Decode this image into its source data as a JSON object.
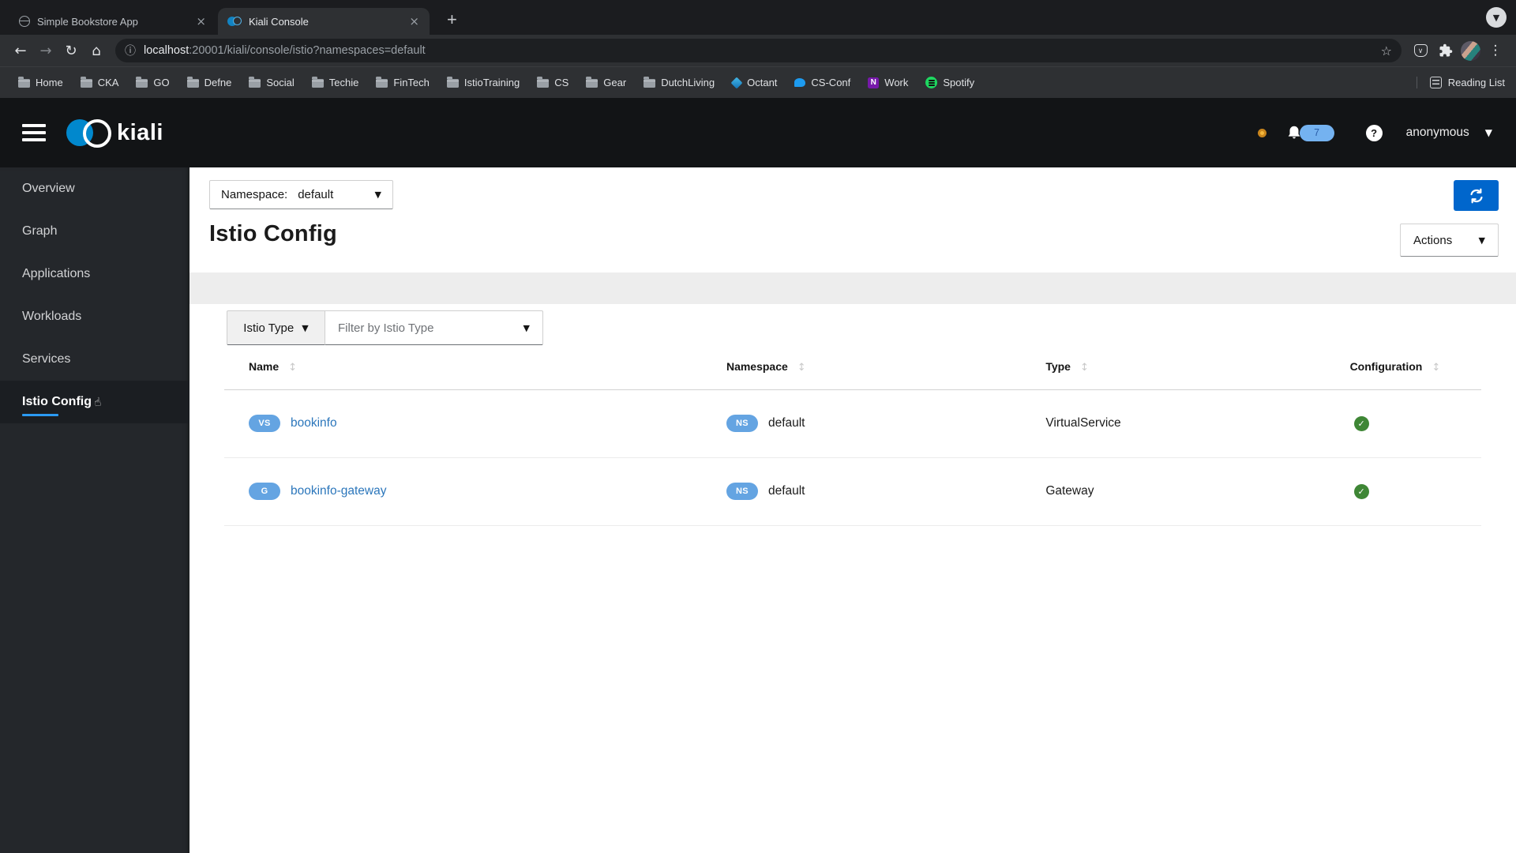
{
  "colors": {
    "kiali_blue": "#0093dd",
    "refresh_blue": "#0066cc",
    "badge_blue": "#64a4e2",
    "success_green": "#3e8635",
    "link_blue": "#2b76bb",
    "nav_underline": "#2b9af3",
    "notif_bg": "#74b2f0",
    "warning_orange": "#f0ab00"
  },
  "browser": {
    "tabs": [
      {
        "title": "Simple Bookstore App",
        "icon": "globe-favicon"
      },
      {
        "title": "Kiali Console",
        "icon": "kiali-favicon",
        "active": true
      }
    ],
    "new_tab_label": "+",
    "url": {
      "host": "localhost",
      "rest": ":20001/kiali/console/istio?namespaces=default"
    },
    "bookmarks": [
      {
        "label": "Home",
        "icon": "folder"
      },
      {
        "label": "CKA",
        "icon": "folder"
      },
      {
        "label": "GO",
        "icon": "folder"
      },
      {
        "label": "Defne",
        "icon": "folder"
      },
      {
        "label": "Social",
        "icon": "folder"
      },
      {
        "label": "Techie",
        "icon": "folder"
      },
      {
        "label": "FinTech",
        "icon": "folder"
      },
      {
        "label": "IstioTraining",
        "icon": "folder"
      },
      {
        "label": "CS",
        "icon": "folder"
      },
      {
        "label": "Gear",
        "icon": "folder"
      },
      {
        "label": "DutchLiving",
        "icon": "folder"
      },
      {
        "label": "Octant",
        "icon": "octant"
      },
      {
        "label": "CS-Conf",
        "icon": "twitter"
      },
      {
        "label": "Work",
        "icon": "onenote"
      },
      {
        "label": "Spotify",
        "icon": "spotify"
      }
    ],
    "reading_list_label": "Reading List"
  },
  "masthead": {
    "brand": "kiali",
    "notification_count": "7",
    "help_label": "?",
    "user": "anonymous"
  },
  "sidebar": {
    "items": [
      {
        "label": "Overview"
      },
      {
        "label": "Graph"
      },
      {
        "label": "Applications"
      },
      {
        "label": "Workloads"
      },
      {
        "label": "Services"
      },
      {
        "label": "Istio Config",
        "active": true
      }
    ]
  },
  "page": {
    "namespace_label": "Namespace:",
    "namespace_value": "default",
    "title": "Istio Config",
    "actions_label": "Actions",
    "filter_type_label": "Istio Type",
    "filter_placeholder": "Filter by Istio Type",
    "table": {
      "columns": [
        "Name",
        "Namespace",
        "Type",
        "Configuration"
      ],
      "rows": [
        {
          "badge": "VS",
          "name": "bookinfo",
          "ns_badge": "NS",
          "namespace": "default",
          "type": "VirtualService",
          "config_status": "valid"
        },
        {
          "badge": "G",
          "name": "bookinfo-gateway",
          "ns_badge": "NS",
          "namespace": "default",
          "type": "Gateway",
          "config_status": "valid"
        }
      ]
    }
  }
}
